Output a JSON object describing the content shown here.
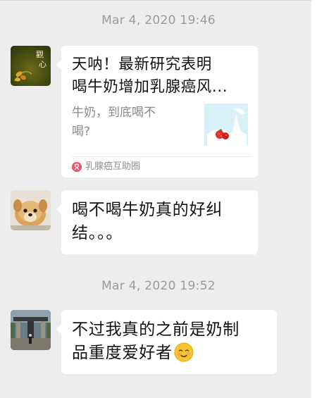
{
  "timestamps": [
    "Mar 4, 2020 19:46",
    "Mar 4, 2020 19:52"
  ],
  "messages": [
    {
      "type": "link-card",
      "avatar": "calligraphy-flower-avatar",
      "title": "天呐！最新研究表明\n喝牛奶增加乳腺癌风...",
      "description": "牛奶，到底喝不\n喝?",
      "thumbnail": "milk-splash-strawberries-image",
      "source": "乳腺癌互助圈"
    },
    {
      "type": "text",
      "avatar": "puppy-avatar",
      "text": "喝不喝牛奶真的好纠\n结。。。"
    },
    {
      "type": "text",
      "avatar": "building-photo-avatar",
      "text": "不过我真的之前是奶制\n品重度爱好者",
      "emoji": "smiling-face-emoji"
    }
  ],
  "colors": {
    "background": "#ededed",
    "bubble": "#ffffff",
    "timestamp": "#9b9b9b",
    "source_icon": "#e8566b"
  }
}
